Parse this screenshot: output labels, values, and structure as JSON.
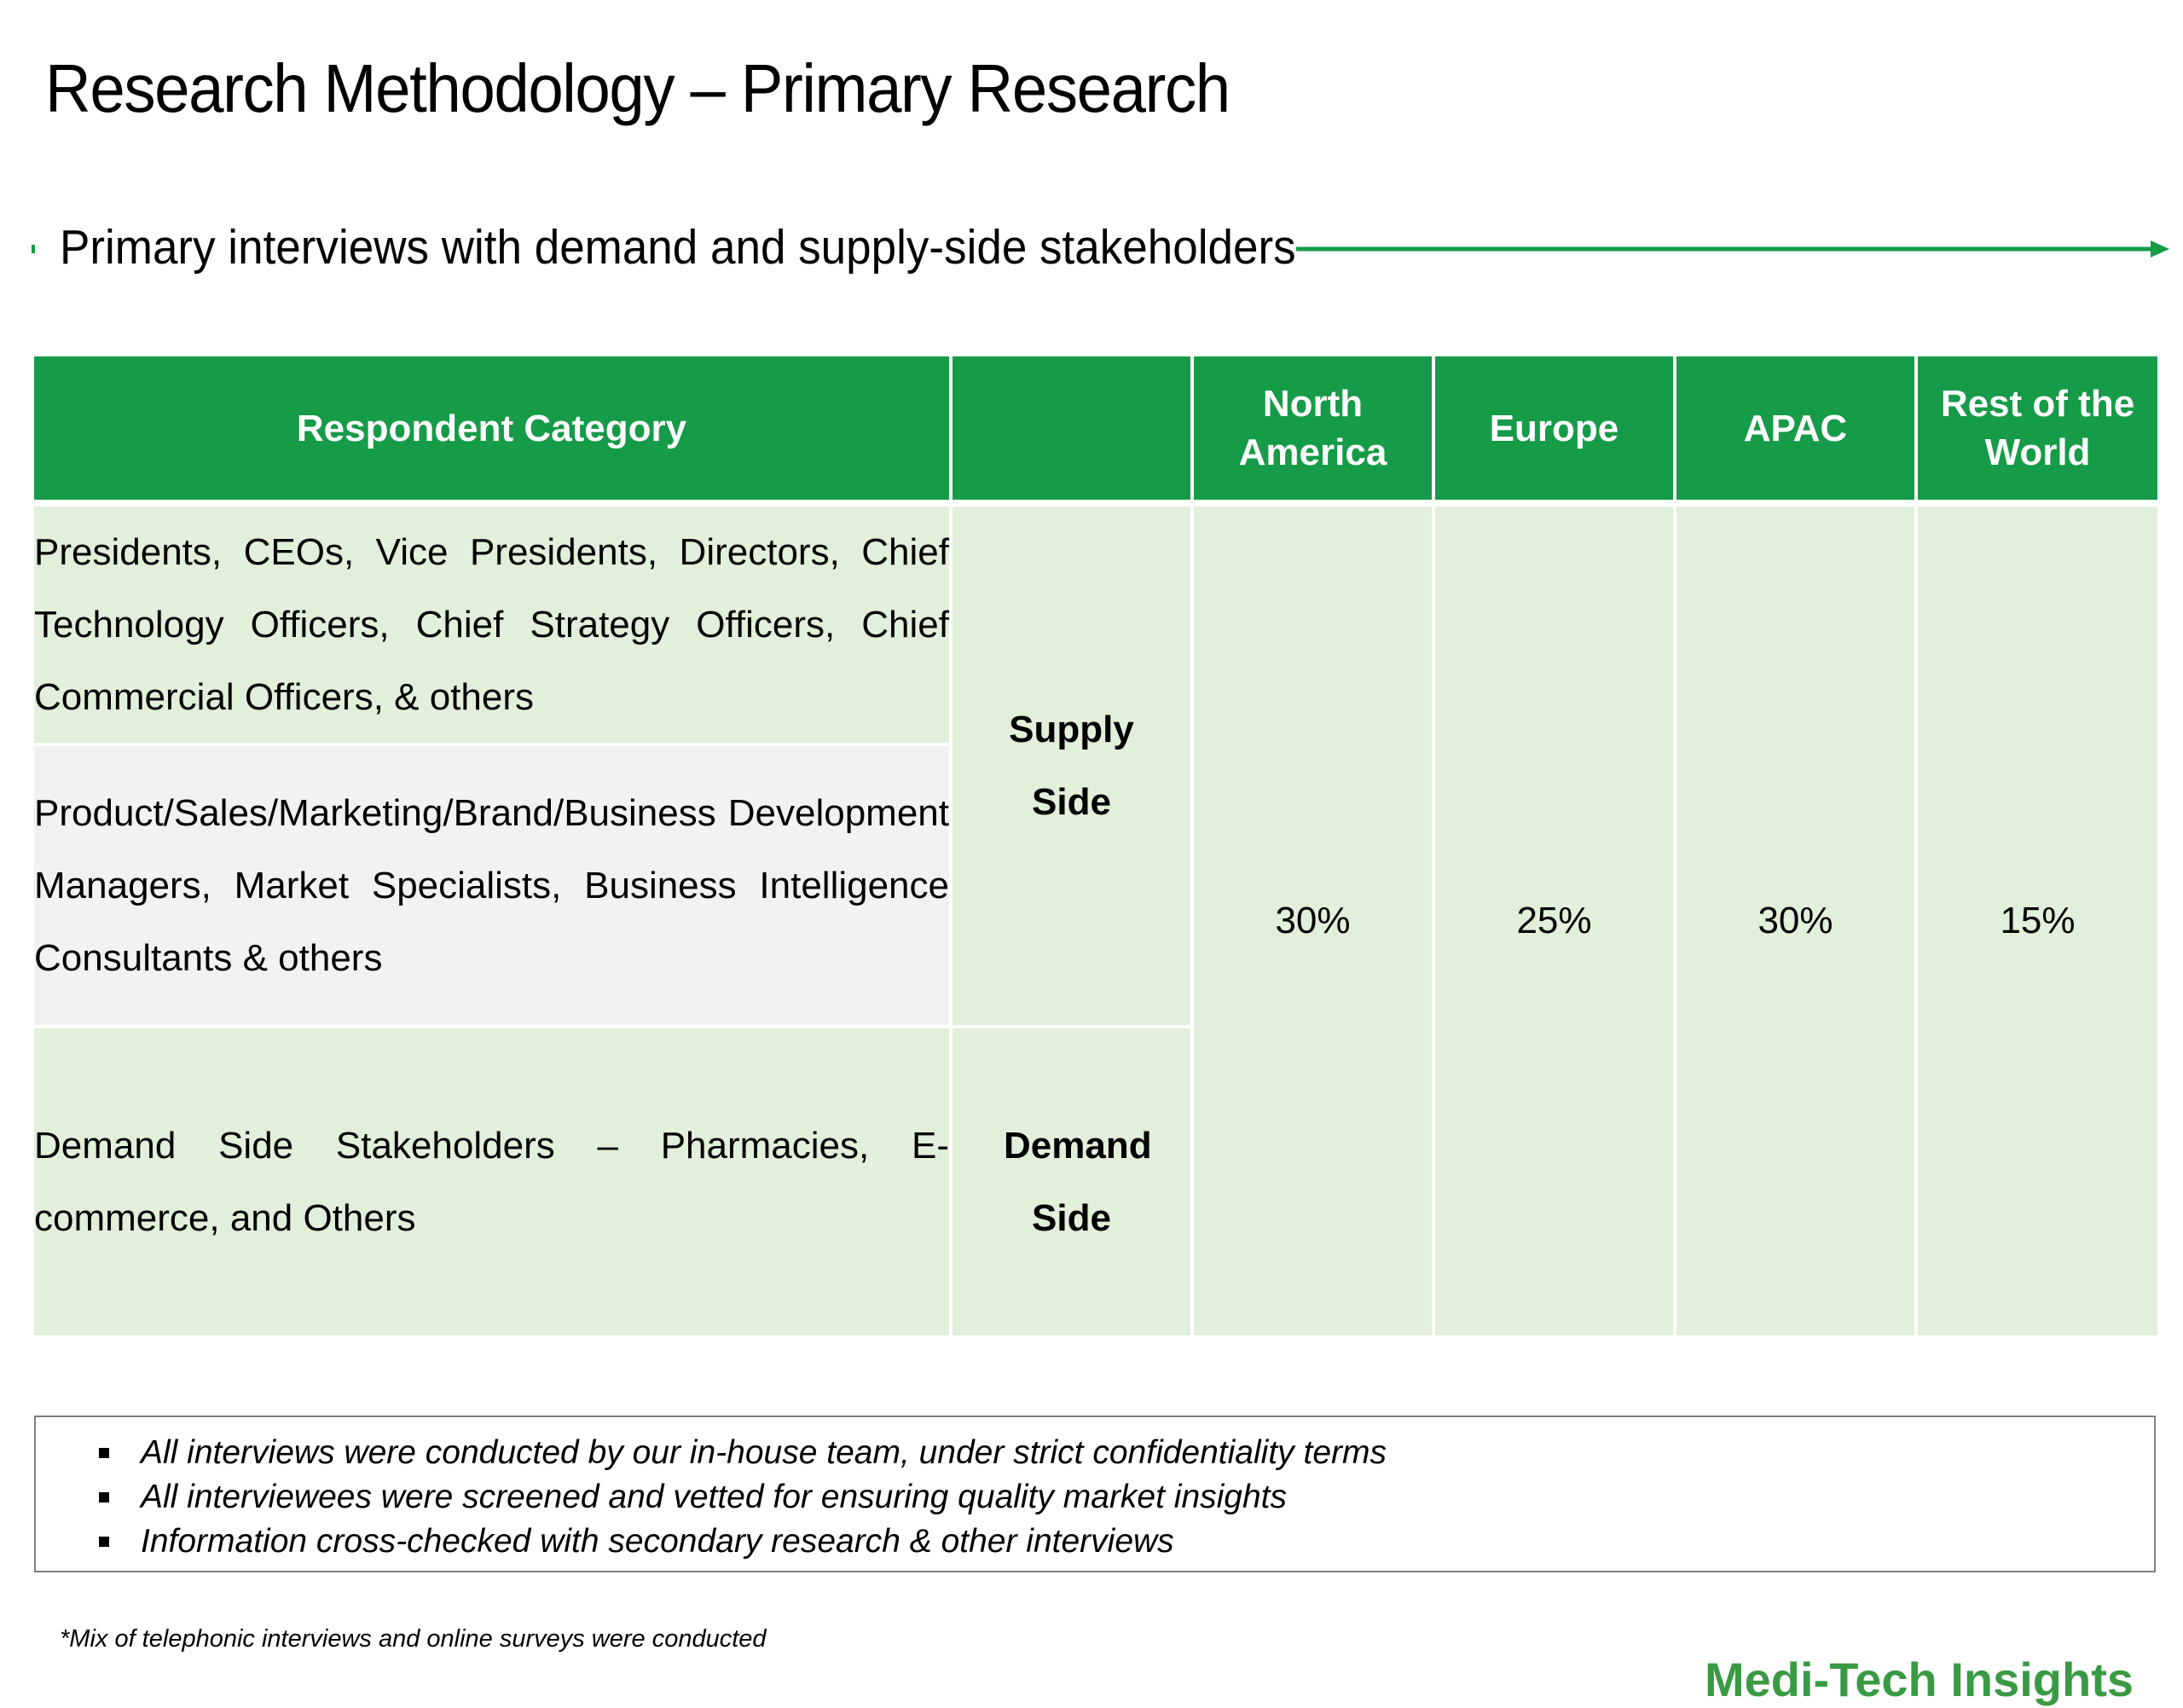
{
  "title": "Research Methodology – Primary Research",
  "subtitle": "Primary interviews with demand and supply-side stakeholders",
  "colors": {
    "accent": "#169b48",
    "row_green": "#e2efda",
    "row_grey": "#f2f2f2",
    "logo": "#3a9a44"
  },
  "table": {
    "headers": [
      "Respondent Category",
      "",
      "North America",
      "Europe",
      "APAC",
      "Rest of the World"
    ],
    "rows": [
      "Presidents, CEOs, Vice Presidents, Directors, Chief Technology Officers, Chief Strategy Officers, Chief Commercial Officers, & others",
      "Product/Sales/Marketing/Brand/Business Development Managers, Market Specialists, Business Intelligence Consultants & others",
      "Demand Side Stakeholders – Pharmacies, E-commerce, and Others"
    ],
    "sides": [
      "Supply Side",
      "Demand Side"
    ],
    "shares": [
      "30%",
      "25%",
      "30%",
      "15%"
    ]
  },
  "notes": [
    "All interviews were conducted by our in-house team, under strict confidentiality terms",
    "All interviewees were screened and vetted for ensuring quality market insights",
    "Information cross-checked with secondary research & other interviews"
  ],
  "footnote": "*Mix of telephonic interviews and online surveys were conducted",
  "logo_text": "Medi-Tech Insights"
}
